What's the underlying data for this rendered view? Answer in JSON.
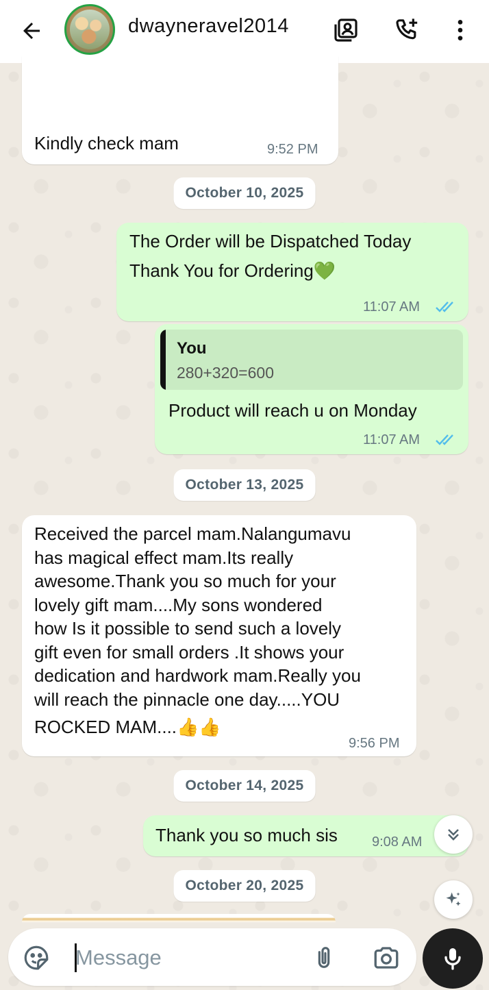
{
  "header": {
    "contact_name": "dwayneravel2014"
  },
  "messages": [
    {
      "id": "m1",
      "direction": "in",
      "text": "Kindly check mam",
      "time": "9:52 PM"
    },
    {
      "id": "m2",
      "direction": "out",
      "text_line1": "The Order will be Dispatched Today",
      "text_line2": "Thank You for Ordering💚",
      "time": "11:07 AM",
      "status": "read"
    },
    {
      "id": "m3",
      "direction": "out",
      "quote_author": "You",
      "quote_text": "280+320=600",
      "text": "Product will reach u on Monday",
      "time": "11:07 AM",
      "status": "read"
    },
    {
      "id": "m4",
      "direction": "in",
      "lines": [
        "Received the parcel mam.Nalangumavu",
        "has magical effect mam.Its really",
        "awesome.Thank you so much for your",
        "lovely gift mam....My sons wondered",
        "how Is it possible to send such a lovely",
        "gift even for small orders .It shows your",
        "dedication and hardwork mam.Really you",
        "will reach the pinnacle one day.....YOU",
        "ROCKED MAM....👍👍"
      ],
      "time": "9:56 PM"
    },
    {
      "id": "m5",
      "direction": "out",
      "text": "Thank you so much sis",
      "time": "9:08 AM"
    }
  ],
  "dates": [
    "October 10, 2025",
    "October 13, 2025",
    "October 14, 2025",
    "October 20, 2025"
  ],
  "composer": {
    "placeholder": "Message"
  },
  "colors": {
    "incoming_bubble": "#ffffff",
    "outgoing_bubble": "#d9fdd3",
    "read_ticks": "#53bdeb",
    "chat_background": "#efeae2"
  }
}
